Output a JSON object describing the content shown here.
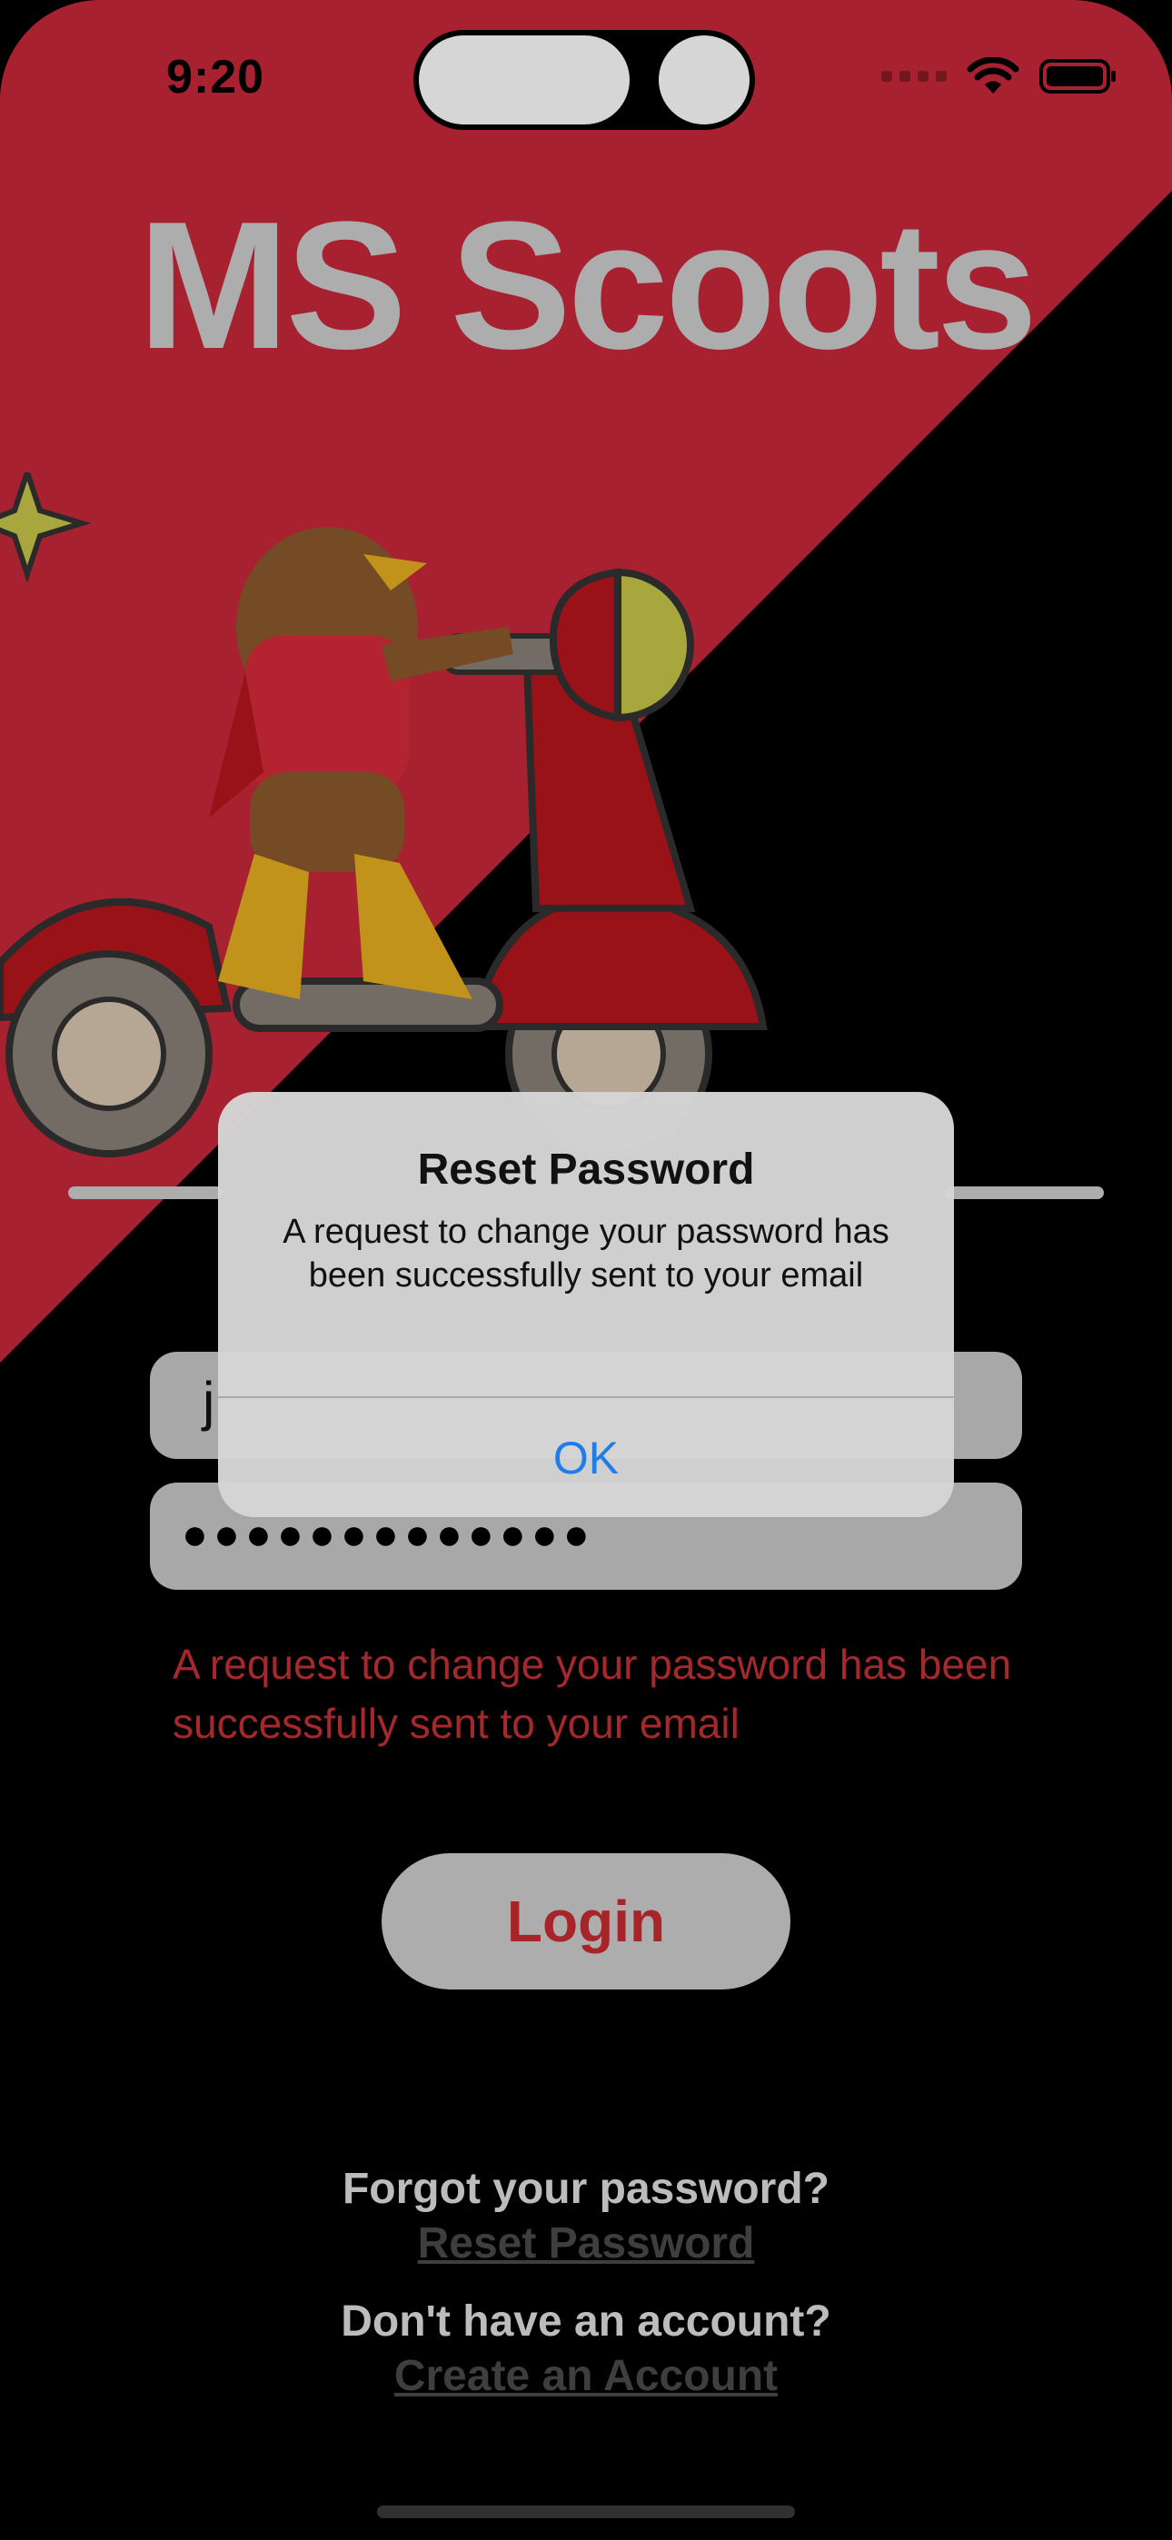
{
  "status_bar": {
    "time": "9:20"
  },
  "app": {
    "title": "MS Scoots"
  },
  "form": {
    "email_value": "j",
    "password_masked": "●●●●●●●●●●●●●",
    "error_message": "A request to change your password has been successfully sent to your email",
    "login_label": "Login"
  },
  "links": {
    "forgot_label": "Forgot your password?",
    "reset_label": "Reset Password",
    "no_account_label": "Don't have an account?",
    "create_label": "Create an Account"
  },
  "alert": {
    "title": "Reset Password",
    "message": "A request to change your password has been successfully sent to your email",
    "ok_label": "OK"
  },
  "colors": {
    "brand_red": "#c8283a",
    "background": "#000000",
    "link_blue": "#1f7ce8"
  }
}
